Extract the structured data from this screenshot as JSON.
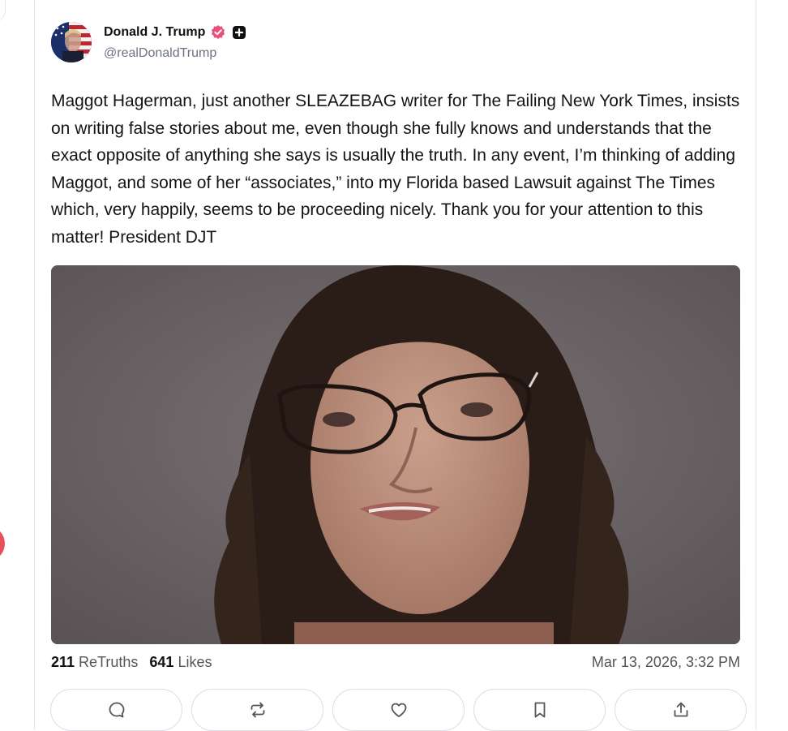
{
  "author": {
    "display_name": "Donald J. Trump",
    "handle": "@realDonaldTrump",
    "avatar_icon": "avatar-flag-portrait",
    "verified_badge_color": "#e6507a",
    "plus_badge_icon": "plus-badge-icon"
  },
  "post": {
    "text": "Maggot Hagerman, just another SLEAZEBAG writer for The Failing New York Times, insists on writing false stories about me, even though she fully knows and understands that the exact opposite of anything she says is usually the truth. In any event, I’m thinking of adding Maggot, and some of her “associates,” into my Florida based Lawsuit against The Times which, very happily, seems to be proceeding nicely. Thank you for your attention to this matter! President DJT",
    "media_description_icon": "portrait-photo"
  },
  "stats": {
    "retruths_count": "211",
    "retruths_label": "ReTruths",
    "likes_count": "641",
    "likes_label": "Likes",
    "timestamp": "Mar 13, 2026, 3:32 PM"
  },
  "actions": [
    {
      "name": "reply",
      "icon": "reply-icon"
    },
    {
      "name": "retruth",
      "icon": "retruth-icon"
    },
    {
      "name": "like",
      "icon": "heart-icon"
    },
    {
      "name": "bookmark",
      "icon": "bookmark-icon"
    },
    {
      "name": "share",
      "icon": "share-icon"
    }
  ],
  "colors": {
    "text": "#141414",
    "muted": "#6b7280",
    "border": "#dcdde2",
    "accent_pink": "#e6507a"
  }
}
